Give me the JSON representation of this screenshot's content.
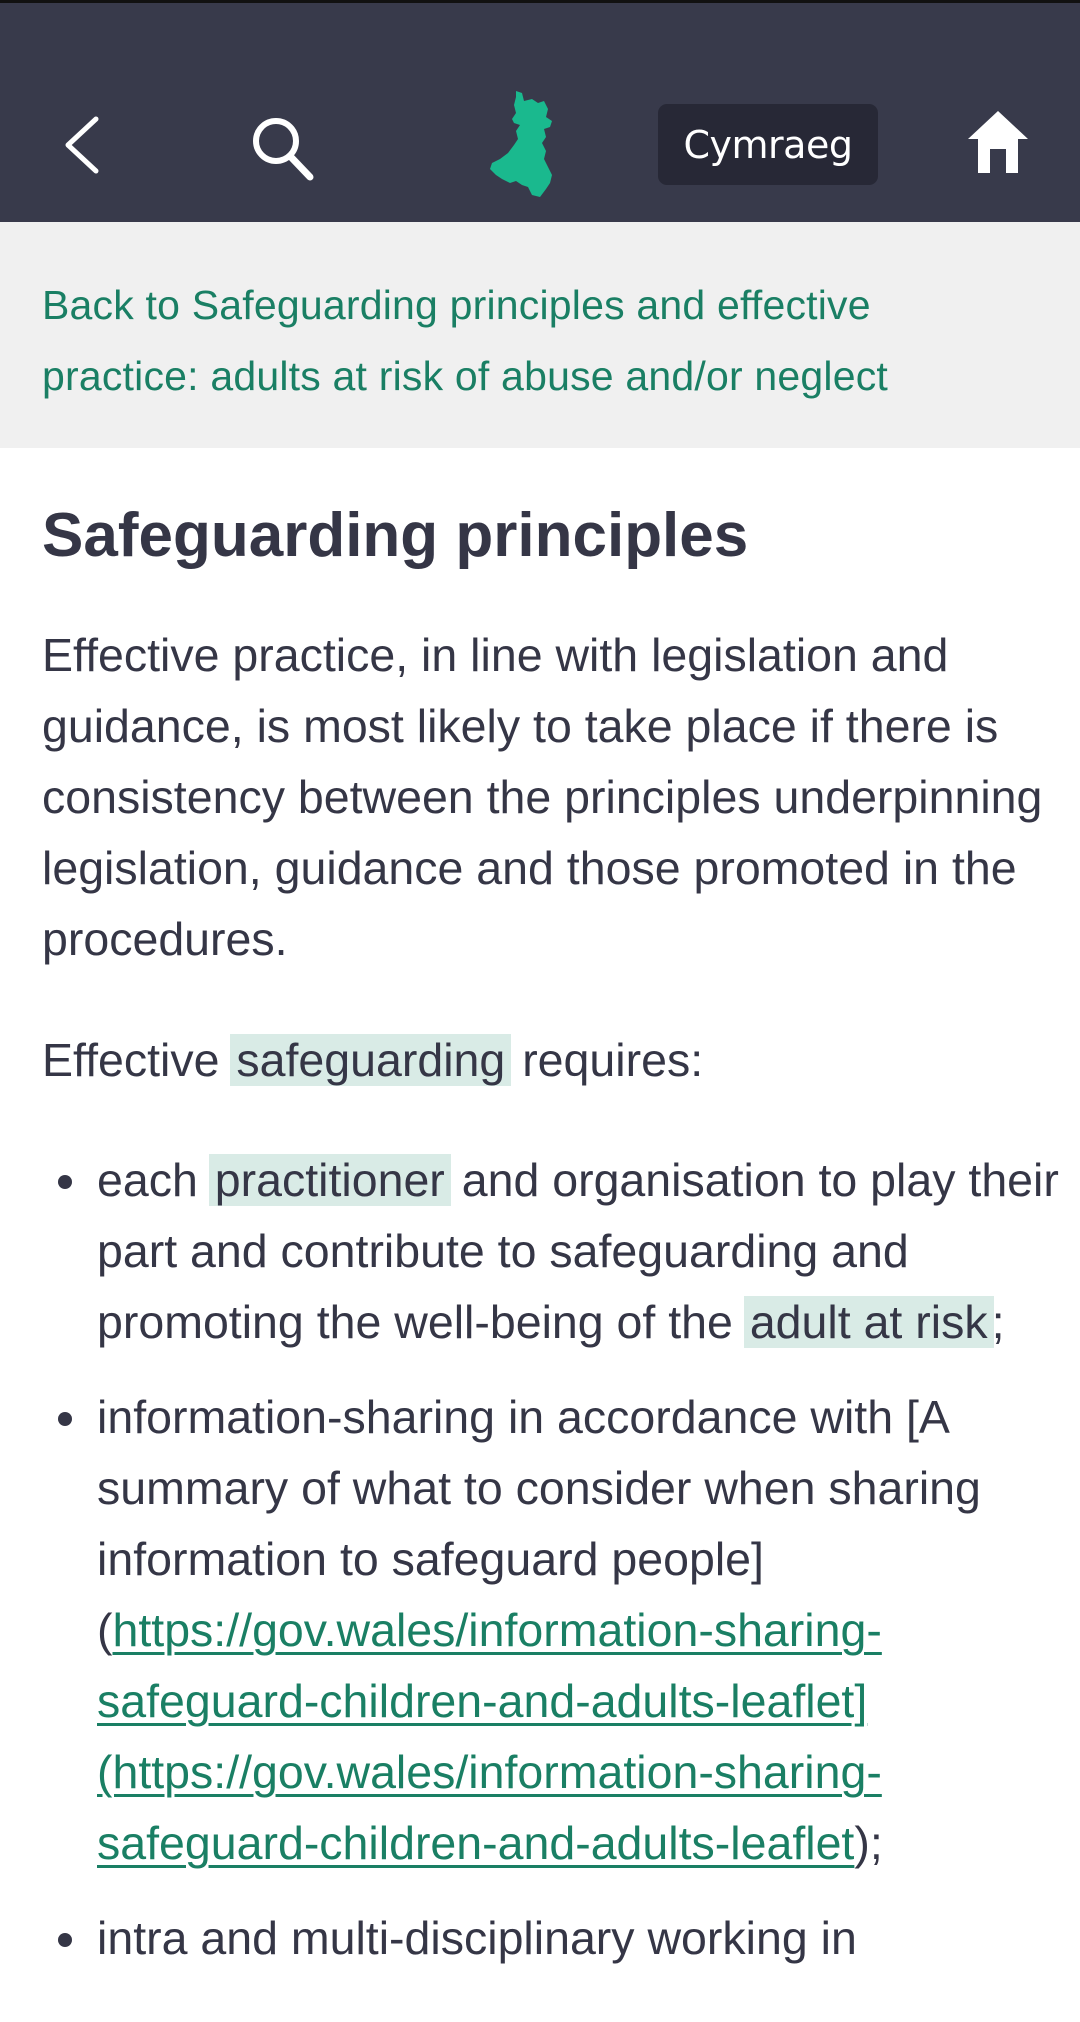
{
  "header": {
    "back_icon": "chevron-left-icon",
    "search_icon": "search-icon",
    "logo_icon": "wales-map-logo-icon",
    "language_button": "Cymraeg",
    "home_icon": "home-icon",
    "colors": {
      "background": "#383a4b",
      "logo": "#1ab98e",
      "language_button_bg": "#272836"
    }
  },
  "back_link": {
    "label": "Back to Safeguarding principles and effective practice: adults at risk of abuse and/or neglect",
    "color": "#1a7f64"
  },
  "content": {
    "title": "Safeguarding principles",
    "intro": "Effective practice, in line with legislation and guidance, is most likely to take place if there is consistency between the principles underpinning legislation, guidance and those promoted in the procedures.",
    "requires": {
      "before": "Effective ",
      "term": "safeguarding",
      "after": " requires:"
    },
    "bullets": [
      {
        "pre": "each ",
        "term1": "practitioner",
        "mid": " and organisation to play their part and contribute to safeguarding and promoting the well-being of the ",
        "term2": "adult at risk",
        "post": ";"
      },
      {
        "pre": "information-sharing in accordance with [A summary of what to consider when sharing information to safeguard people](",
        "link1": "https://gov.wales/information-sharing-safeguard-children-and-adults-leaflet]",
        "link2": "(https://gov.wales/information-sharing-safeguard-children-and-adults-leaflet",
        "post": ");"
      },
      {
        "text": "intra and multi-disciplinary working in"
      }
    ]
  }
}
